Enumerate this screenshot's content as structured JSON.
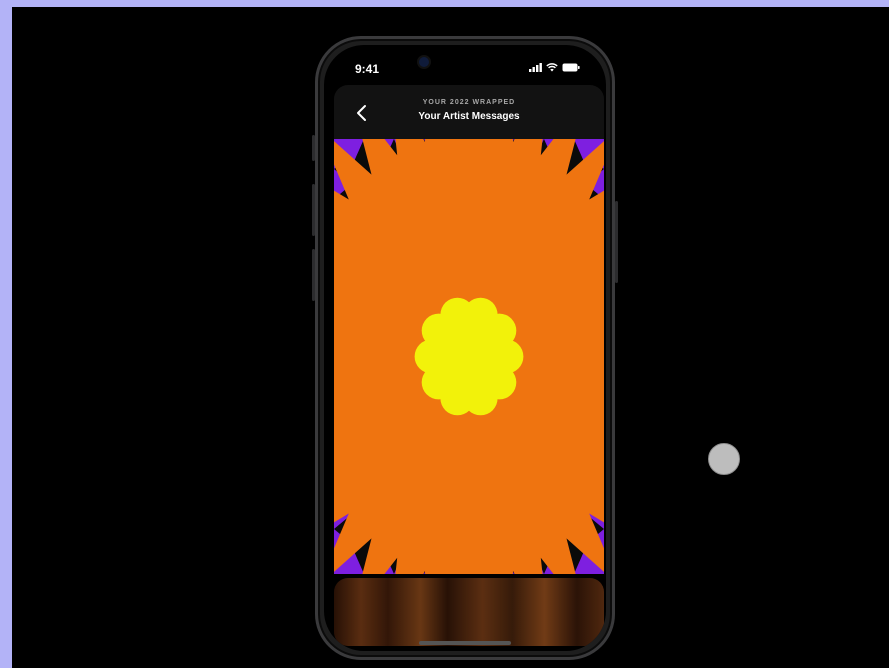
{
  "status_bar": {
    "time": "9:41",
    "icons": [
      "signal-icon",
      "wifi-icon",
      "battery-icon"
    ]
  },
  "header": {
    "eyebrow": "YOUR 2022 WRAPPED",
    "title": "Your Artist Messages",
    "back_icon": "chevron-left-icon"
  },
  "colors": {
    "art_orange": "#ef7410",
    "art_yellow": "#f2f20a",
    "art_purple": "#7e1fe0",
    "art_black": "#0a0a0a",
    "wood_dark": "#3b1a0a",
    "wood_light": "#8a4a1f"
  }
}
